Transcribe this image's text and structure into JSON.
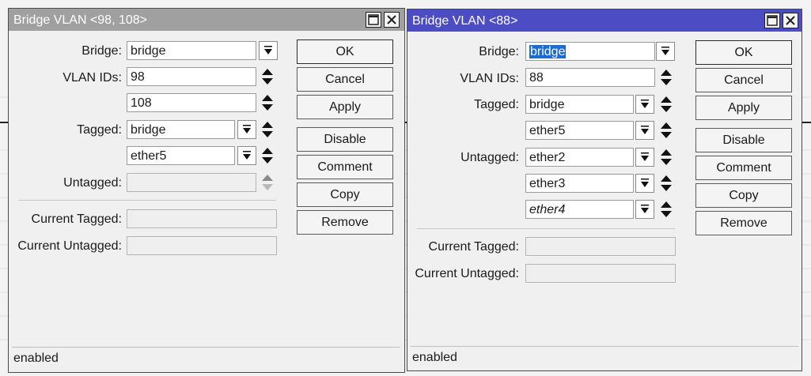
{
  "left_dialog": {
    "title": "Bridge VLAN <98, 108>",
    "labels": {
      "bridge": "Bridge:",
      "vlan_ids": "VLAN IDs:",
      "tagged": "Tagged:",
      "untagged": "Untagged:",
      "current_tagged": "Current Tagged:",
      "current_untagged": "Current Untagged:"
    },
    "bridge": "bridge",
    "vlan_ids": [
      "98",
      "108"
    ],
    "tagged": [
      "bridge",
      "ether5"
    ],
    "untagged": "",
    "current_tagged": "",
    "current_untagged": "",
    "buttons": [
      "OK",
      "Cancel",
      "Apply",
      "Disable",
      "Comment",
      "Copy",
      "Remove"
    ],
    "status": "enabled"
  },
  "right_dialog": {
    "title": "Bridge VLAN <88>",
    "labels": {
      "bridge": "Bridge:",
      "vlan_ids": "VLAN IDs:",
      "tagged": "Tagged:",
      "untagged": "Untagged:",
      "current_tagged": "Current Tagged:",
      "current_untagged": "Current Untagged:"
    },
    "bridge": "bridge",
    "vlan_ids": [
      "88"
    ],
    "tagged": [
      "bridge",
      "ether5"
    ],
    "untagged": [
      "ether2",
      "ether3",
      "ether4"
    ],
    "current_tagged": "",
    "current_untagged": "",
    "buttons": [
      "OK",
      "Cancel",
      "Apply",
      "Disable",
      "Comment",
      "Copy",
      "Remove"
    ],
    "status": "enabled"
  },
  "colors": {
    "inactive_titlebar": "#a0a0a0",
    "active_titlebar": "#4c4cc4",
    "selection": "#1b6ad8"
  }
}
